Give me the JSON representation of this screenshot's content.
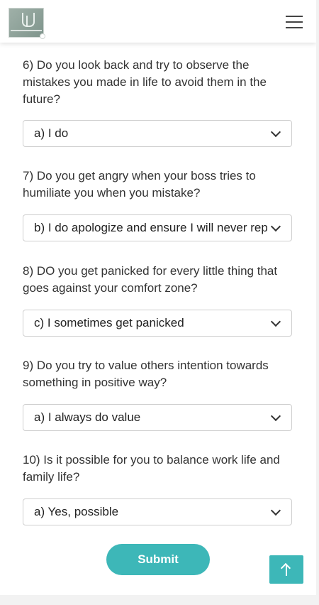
{
  "questions": [
    {
      "text": "6) Do you look back and try to observe the mistakes you made in life to avoid them in the future?",
      "selected": "a) I do"
    },
    {
      "text": "7) Do you get angry when your boss tries to humiliate you when you mistake?",
      "selected": "b) I do apologize and ensure I will never repeat it"
    },
    {
      "text": "8) DO you get panicked for every little thing that goes against your comfort zone?",
      "selected": "c) I sometimes get panicked"
    },
    {
      "text": "9) Do you try to value others intention towards something in positive way?",
      "selected": "a) I always do value"
    },
    {
      "text": "10) Is it possible for you to balance work life and family life?",
      "selected": "a) Yes, possible"
    }
  ],
  "form": {
    "submit_label": "Submit"
  },
  "colors": {
    "accent": "#3db7b8"
  },
  "icons": {
    "menu": "hamburger-menu-icon",
    "dropdown": "chevron-down-icon",
    "scroll_top": "arrow-up-icon"
  }
}
